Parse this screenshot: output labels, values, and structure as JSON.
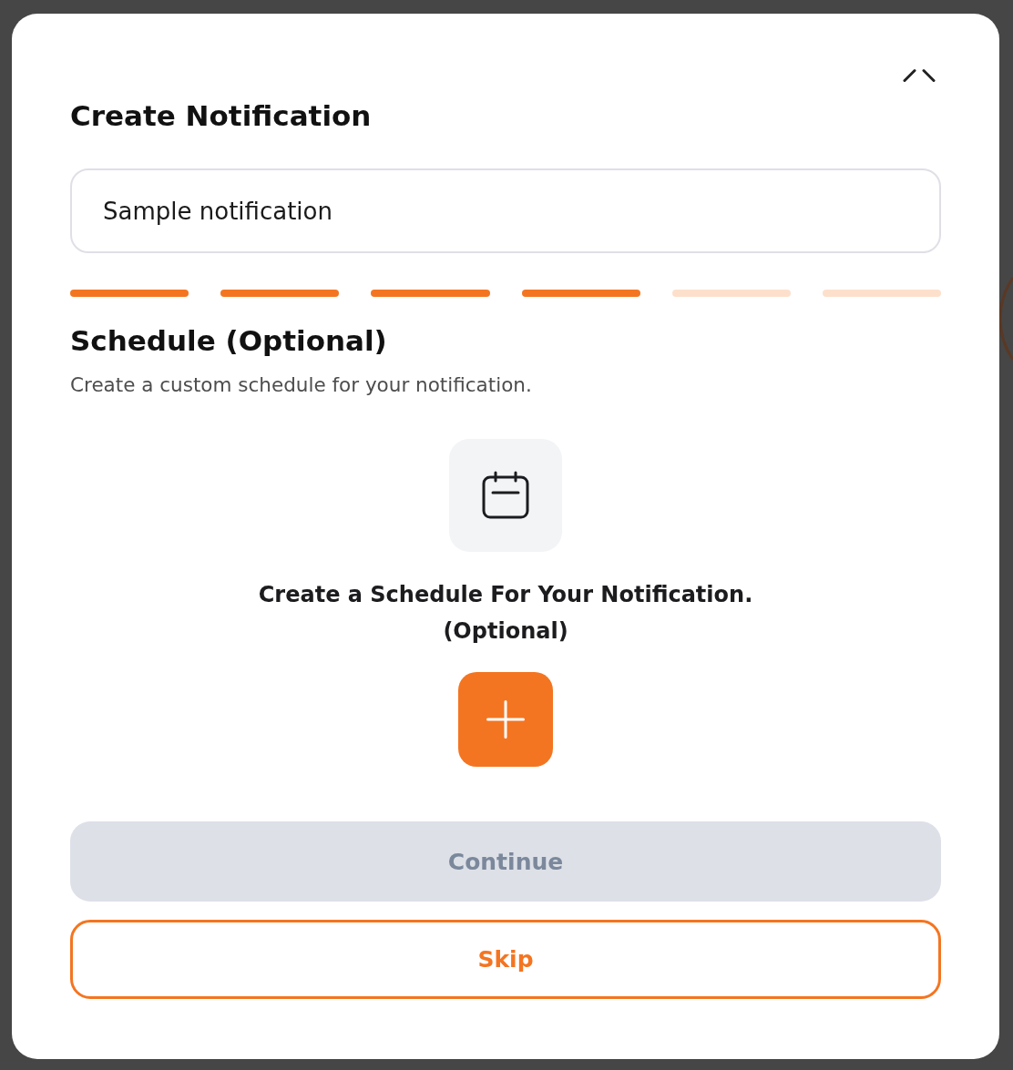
{
  "dialog": {
    "title": "Create Notification",
    "name_field": {
      "value": "Sample notification"
    },
    "steps": [
      {
        "completed": true
      },
      {
        "completed": true
      },
      {
        "completed": true
      },
      {
        "completed": true
      },
      {
        "completed": false
      },
      {
        "completed": false
      }
    ],
    "section": {
      "title": "Schedule (Optional)",
      "description": "Create a custom schedule for your notification."
    },
    "empty_state": {
      "message": "Create a Schedule For Your Notification. (Optional)"
    },
    "buttons": [
      {
        "label": "Continue",
        "kind": "primary",
        "disabled": true
      },
      {
        "label": "Skip",
        "kind": "outline",
        "disabled": false
      }
    ]
  }
}
